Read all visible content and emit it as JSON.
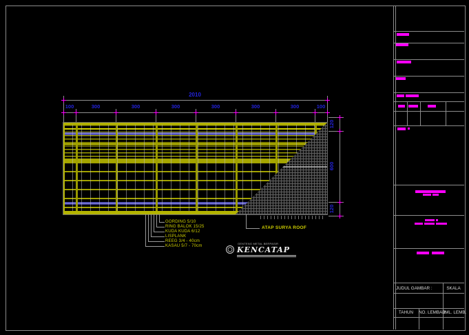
{
  "colors": {
    "background": "#000000",
    "frame_gray": "#8c8c8c",
    "grid_yellow": "#a2a200",
    "dim_text_blue": "#2323dd",
    "tick_magenta": "#ff00ff",
    "label_yellow": "#cfcf00",
    "member_blue": "#8d8de0",
    "hatch_gray": "#5e5e5e"
  },
  "drawing": {
    "total_dim": "2010",
    "top_dims": [
      "100",
      "300",
      "300",
      "300",
      "300",
      "300",
      "300",
      "100"
    ],
    "right_dims": [
      "120",
      "600",
      "120"
    ],
    "material_labels": [
      "GORDING 5/10",
      "RING BALOK 15/25",
      "KUDA KUDA 6/12",
      "LISPLANK",
      "REEG 3/4 - 40cm",
      "KASAU 5/7 - 70cm"
    ],
    "hatch_label": "ATAP SURYA ROOF"
  },
  "logo": {
    "tagline": "GENTENG METAL BERPASIR",
    "brand": "KENCATAP"
  },
  "titleblock": {
    "judul_gambar": "JUDUL GAMBAR :",
    "skala": "SKALA",
    "tahun": "TAHUN",
    "no_lembar": "NO. LEMBAR",
    "jml_lemb": "JML. LEMB."
  }
}
